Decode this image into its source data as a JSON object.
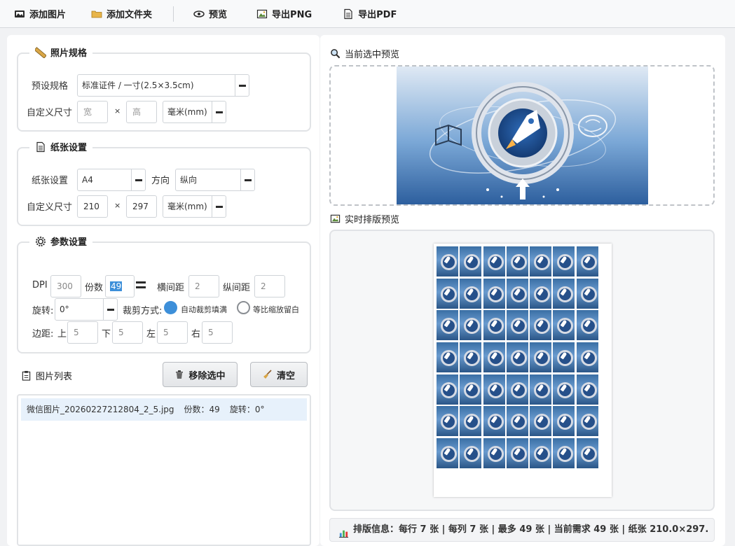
{
  "toolbar": {
    "add_image": "添加图片",
    "add_folder": "添加文件夹",
    "preview": "预览",
    "export_png": "导出PNG",
    "export_pdf": "导出PDF"
  },
  "photo_spec": {
    "title": "照片规格",
    "preset_label": "预设规格",
    "preset_value": "标准证件 / 一寸(2.5×3.5cm)",
    "custom_label": "自定义尺寸",
    "width_placeholder": "宽",
    "times": "×",
    "height_placeholder": "高",
    "unit": "毫米(mm)"
  },
  "paper": {
    "title": "纸张设置",
    "paper_label": "纸张设置",
    "paper_value": "A4",
    "orientation_label": "方向",
    "orientation_value": "纵向",
    "custom_label": "自定义尺寸",
    "width": "210",
    "times": "×",
    "height": "297",
    "unit": "毫米(mm)"
  },
  "params": {
    "title": "参数设置",
    "dpi_label": "DPI",
    "dpi": "300",
    "copies_label": "份数",
    "copies": "49",
    "h_gap_label": "横间距",
    "h_gap": "2",
    "v_gap_label": "纵间距",
    "v_gap": "2",
    "rotation_label": "旋转:",
    "rotation": "0°",
    "crop_label": "裁剪方式:",
    "crop_fill": "自动裁剪填满",
    "crop_fit": "等比缩放留白",
    "margin_label": "边距:",
    "top_label": "上",
    "top": "5",
    "bottom_label": "下",
    "bottom": "5",
    "left_label": "左",
    "left": "5",
    "right_label": "右",
    "right": "5"
  },
  "image_list": {
    "title": "图片列表",
    "remove_button": "移除选中",
    "clear_button": "清空",
    "items": [
      {
        "name": "微信图片_20260227212804_2_5.jpg",
        "copies": "份数：49",
        "rotation": "旋转：0°"
      }
    ]
  },
  "preview": {
    "current_title": "当前选中预览",
    "layout_title": "实时排版预览",
    "grid_cols": 7,
    "grid_rows": 7
  },
  "info_bar": {
    "text": "排版信息：每行 7 张 | 每列 7 张 | 最多 49 张 | 当前需求 49 张 | 纸张 210.0×297."
  },
  "colors": {
    "accent": "#3d8fd9",
    "selection": "#e7f1fb"
  }
}
